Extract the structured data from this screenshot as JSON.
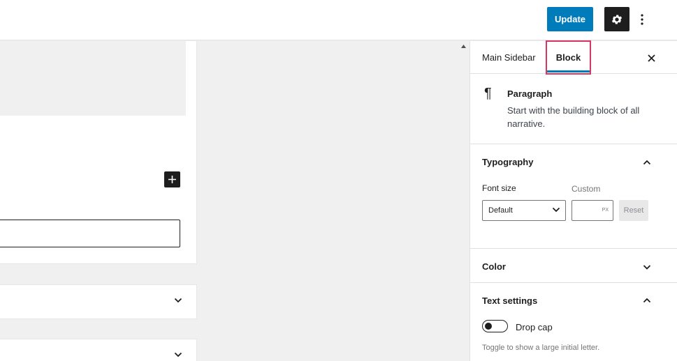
{
  "header": {
    "update_label": "Update",
    "settings_icon": "gear-icon",
    "more_icon": "vertical-ellipsis-icon"
  },
  "sidebar": {
    "tabs": [
      {
        "label": "Main Sidebar",
        "active": false
      },
      {
        "label": "Block",
        "active": true
      }
    ],
    "close_icon": "close-icon",
    "block": {
      "icon": "¶",
      "title": "Paragraph",
      "description": "Start with the building block of all narrative."
    },
    "typography": {
      "title": "Typography",
      "font_size_label": "Font size",
      "custom_label": "Custom",
      "font_size_value": "Default",
      "custom_unit": "PX",
      "reset_label": "Reset"
    },
    "color": {
      "title": "Color"
    },
    "text_settings": {
      "title": "Text settings",
      "drop_cap_label": "Drop cap",
      "drop_cap_help": "Toggle to show a large initial letter."
    }
  },
  "colors": {
    "primary": "#007cba",
    "highlight": "#d63864",
    "dark": "#1e1e1e"
  }
}
